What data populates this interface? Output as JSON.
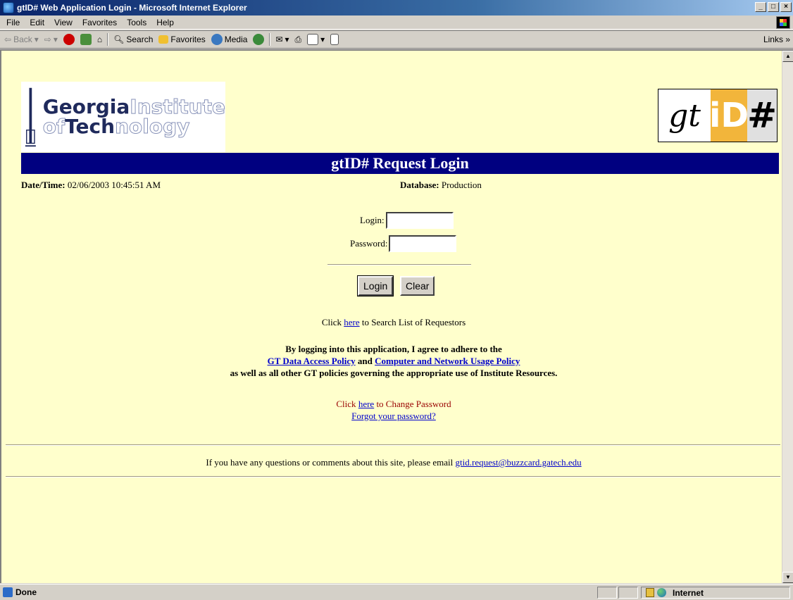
{
  "window": {
    "title": "gtID# Web Application Login - Microsoft Internet Explorer",
    "min": "_",
    "max": "□",
    "close": "×"
  },
  "menu": {
    "items": [
      "File",
      "Edit",
      "View",
      "Favorites",
      "Tools",
      "Help"
    ]
  },
  "toolbar": {
    "back": "Back",
    "search": "Search",
    "favorites": "Favorites",
    "media": "Media",
    "links": "Links"
  },
  "page": {
    "logo_georgia": "Georgia",
    "logo_institute": "Institute",
    "logo_of": "of",
    "logo_tech": "Tech",
    "logo_nology": "nology",
    "gtid_left": "gt",
    "gtid_mid": "iD",
    "gtid_right": "#",
    "banner": "gtID# Request Login",
    "datetime_label": "Date/Time:",
    "datetime_value": "02/06/2003 10:45:51 AM",
    "database_label": "Database:",
    "database_value": "Production",
    "login_label": "Login:",
    "login_value": "",
    "password_label": "Password:",
    "password_value": "",
    "login_button": "Login",
    "clear_button": "Clear",
    "search_prefix": "Click",
    "search_link": "here",
    "search_suffix": "to Search List of Requestors",
    "policy_line1": "By logging into this application, I agree to adhere to the",
    "policy_link1": "GT Data Access Policy",
    "policy_and": "and",
    "policy_link2": "Computer and Network Usage Policy",
    "policy_line3": "as well as all other GT policies governing the appropriate use of Institute Resources.",
    "change_prefix": "Click",
    "change_link": "here",
    "change_suffix": "to Change Password",
    "forgot_link": "Forgot your password?",
    "footer_text": "If you have any questions or comments about this site, please email",
    "footer_email": "gtid.request@buzzcard.gatech.edu"
  },
  "status": {
    "text": "Done",
    "zone": "Internet"
  }
}
